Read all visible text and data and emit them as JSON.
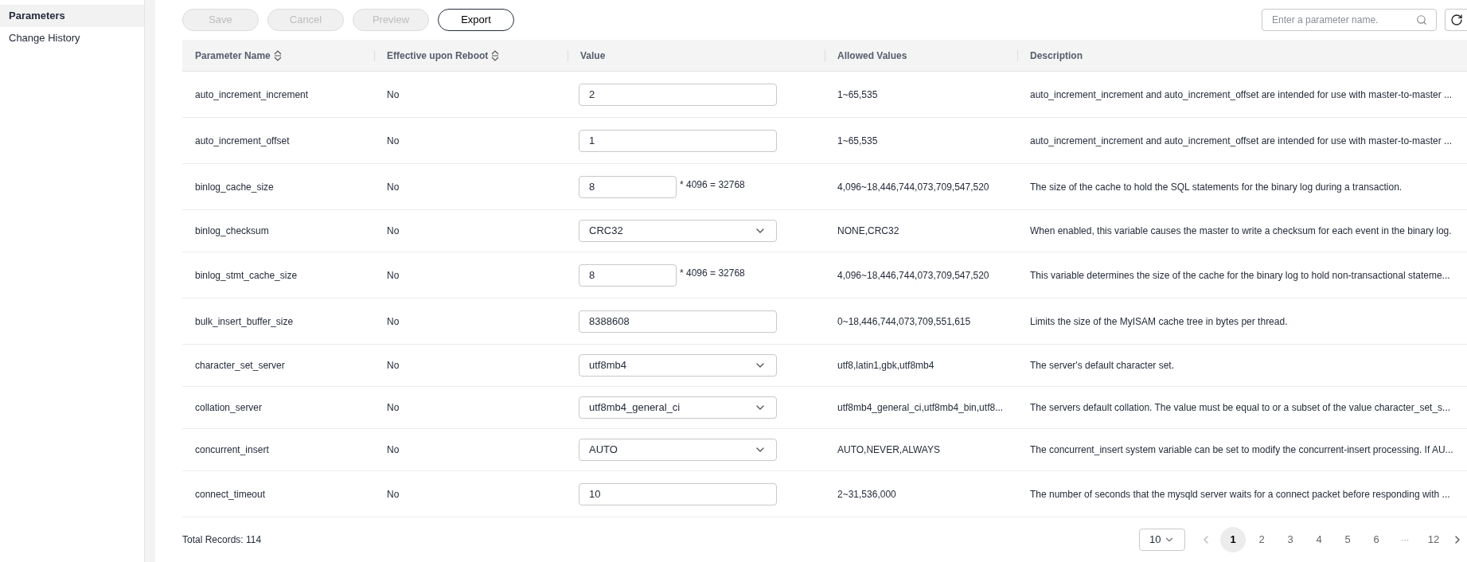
{
  "sidebar": {
    "items": [
      {
        "label": "Parameters",
        "selected": true
      },
      {
        "label": "Change History",
        "selected": false
      }
    ]
  },
  "toolbar": {
    "buttons": [
      {
        "label": "Save",
        "disabled": true
      },
      {
        "label": "Cancel",
        "disabled": true
      },
      {
        "label": "Preview",
        "disabled": true
      },
      {
        "label": "Export",
        "disabled": false
      }
    ],
    "search": {
      "placeholder": "Enter a parameter name."
    }
  },
  "table": {
    "columns": [
      {
        "label": "Parameter Name",
        "sortable": true
      },
      {
        "label": "Effective upon Reboot",
        "sortable": true
      },
      {
        "label": "Value",
        "sortable": false
      },
      {
        "label": "Allowed Values",
        "sortable": false
      },
      {
        "label": "Description",
        "sortable": false
      }
    ],
    "rows": [
      {
        "name": "auto_increment_increment",
        "reboot": "No",
        "value": {
          "kind": "input",
          "text": "2"
        },
        "allowed": "1~65,535",
        "description": "auto_increment_increment and auto_increment_offset are intended for use with master-to-master ..."
      },
      {
        "name": "auto_increment_offset",
        "reboot": "No",
        "value": {
          "kind": "input",
          "text": "1"
        },
        "allowed": "1~65,535",
        "description": "auto_increment_increment and auto_increment_offset are intended for use with master-to-master ..."
      },
      {
        "name": "binlog_cache_size",
        "reboot": "No",
        "value": {
          "kind": "multiplier",
          "text": "8",
          "suffix": "* 4096 = 32768"
        },
        "allowed": "4,096~18,446,744,073,709,547,520",
        "description": "The size of the cache to hold the SQL statements for the binary log during a transaction."
      },
      {
        "name": "binlog_checksum",
        "reboot": "No",
        "value": {
          "kind": "select",
          "text": "CRC32"
        },
        "allowed": "NONE,CRC32",
        "description": "When enabled, this variable causes the master to write a checksum for each event in the binary log."
      },
      {
        "name": "binlog_stmt_cache_size",
        "reboot": "No",
        "value": {
          "kind": "multiplier",
          "text": "8",
          "suffix": "* 4096 = 32768"
        },
        "allowed": "4,096~18,446,744,073,709,547,520",
        "description": "This variable determines the size of the cache for the binary log to hold non-transactional stateme..."
      },
      {
        "name": "bulk_insert_buffer_size",
        "reboot": "No",
        "value": {
          "kind": "input",
          "text": "8388608"
        },
        "allowed": "0~18,446,744,073,709,551,615",
        "description": "Limits the size of the MyISAM cache tree in bytes per thread."
      },
      {
        "name": "character_set_server",
        "reboot": "No",
        "value": {
          "kind": "select",
          "text": "utf8mb4"
        },
        "allowed": "utf8,latin1,gbk,utf8mb4",
        "description": "The server's default character set."
      },
      {
        "name": "collation_server",
        "reboot": "No",
        "value": {
          "kind": "select",
          "text": "utf8mb4_general_ci"
        },
        "allowed": "utf8mb4_general_ci,utf8mb4_bin,utf8...",
        "description": "The servers default collation. The value must be equal to or a subset of the value character_set_s..."
      },
      {
        "name": "concurrent_insert",
        "reboot": "No",
        "value": {
          "kind": "select",
          "text": "AUTO"
        },
        "allowed": "AUTO,NEVER,ALWAYS",
        "description": "The concurrent_insert system variable can be set to modify the concurrent-insert processing. If AU..."
      },
      {
        "name": "connect_timeout",
        "reboot": "No",
        "value": {
          "kind": "input",
          "text": "10"
        },
        "allowed": "2~31,536,000",
        "description": "The number of seconds that the mysqld server waits for a connect packet before responding with ..."
      }
    ]
  },
  "footer": {
    "total": "Total Records: 114",
    "page_size": "10",
    "pages": [
      {
        "label": "1",
        "kind": "page",
        "selected": true
      },
      {
        "label": "2",
        "kind": "page",
        "selected": false
      },
      {
        "label": "3",
        "kind": "page",
        "selected": false
      },
      {
        "label": "4",
        "kind": "page",
        "selected": false
      },
      {
        "label": "5",
        "kind": "page",
        "selected": false
      },
      {
        "label": "6",
        "kind": "page",
        "selected": false
      },
      {
        "label": "···",
        "kind": "ellipsis"
      },
      {
        "label": "12",
        "kind": "page",
        "selected": false
      }
    ]
  }
}
